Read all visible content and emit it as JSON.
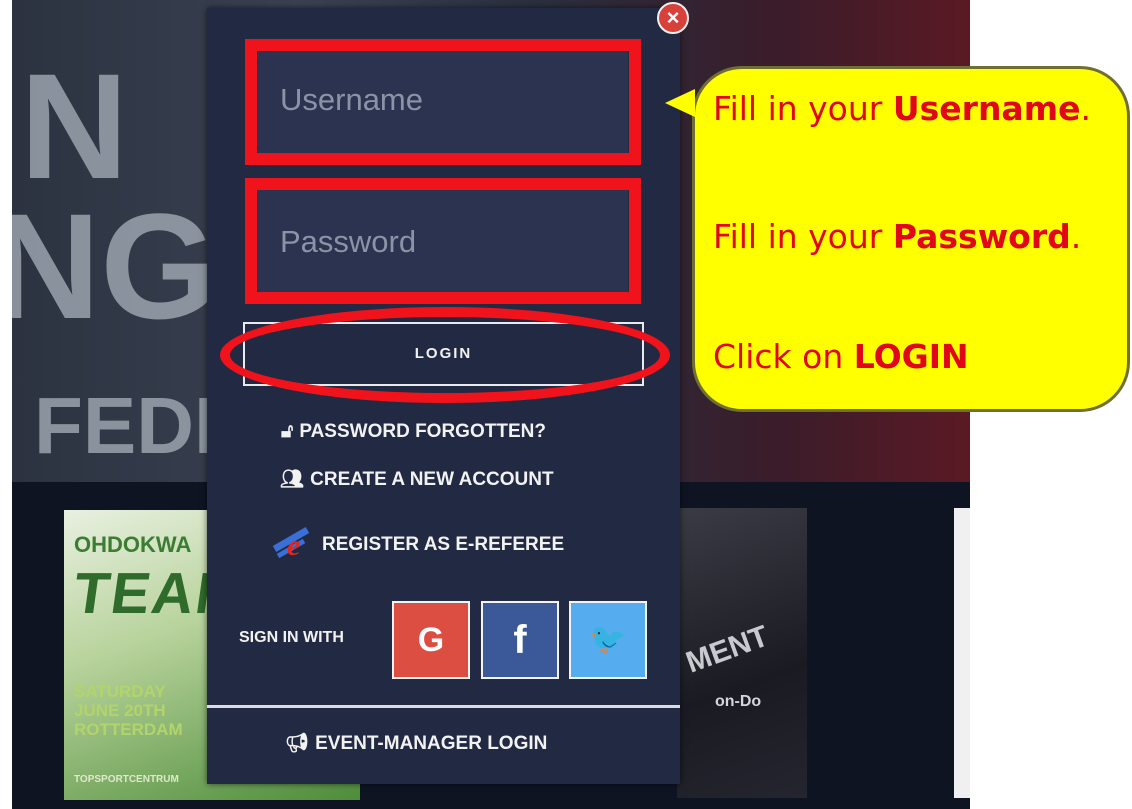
{
  "background": {
    "hero_letters": [
      "N",
      "NG",
      "FEDE"
    ],
    "card_left": {
      "heading": "OHDOKWA",
      "title": "TEAM",
      "date_lines": [
        "SATURDAY",
        "JUNE 20TH",
        "ROTTERDAM"
      ],
      "footer": "TOPSPORTCENTRUM"
    },
    "card_right": {
      "title": "MENT",
      "subtitle": "on-Do"
    }
  },
  "modal": {
    "close_label": "×",
    "username_placeholder": "Username",
    "password_placeholder": "Password",
    "login_label": "LOGIN",
    "password_forgotten": "PASSWORD FORGOTTEN?",
    "create_account": "CREATE A NEW ACCOUNT",
    "register_ereferee": "REGISTER AS E-REFEREE",
    "sign_in_with": "SIGN IN WITH",
    "social": {
      "google": "G",
      "facebook": "f",
      "twitter": "🐦"
    },
    "event_manager_login": "EVENT-MANAGER LOGIN",
    "icons": {
      "password_forgotten": "unlock-icon",
      "create_account": "add-user-icon",
      "event_manager": "megaphone-icon"
    }
  },
  "callout": {
    "line1_prefix": "Fill in your ",
    "line1_bold": "Username",
    "line1_suffix": ".",
    "line2_prefix": "Fill in your ",
    "line2_bold": "Password",
    "line2_suffix": ".",
    "line3_prefix": "Click on ",
    "line3_bold": "LOGIN"
  },
  "colors": {
    "highlight_red": "#f0131b",
    "callout_yellow": "#ffff00",
    "modal_bg": "#222942",
    "google": "#dc4e41",
    "facebook": "#3b5998",
    "twitter": "#55acee"
  }
}
